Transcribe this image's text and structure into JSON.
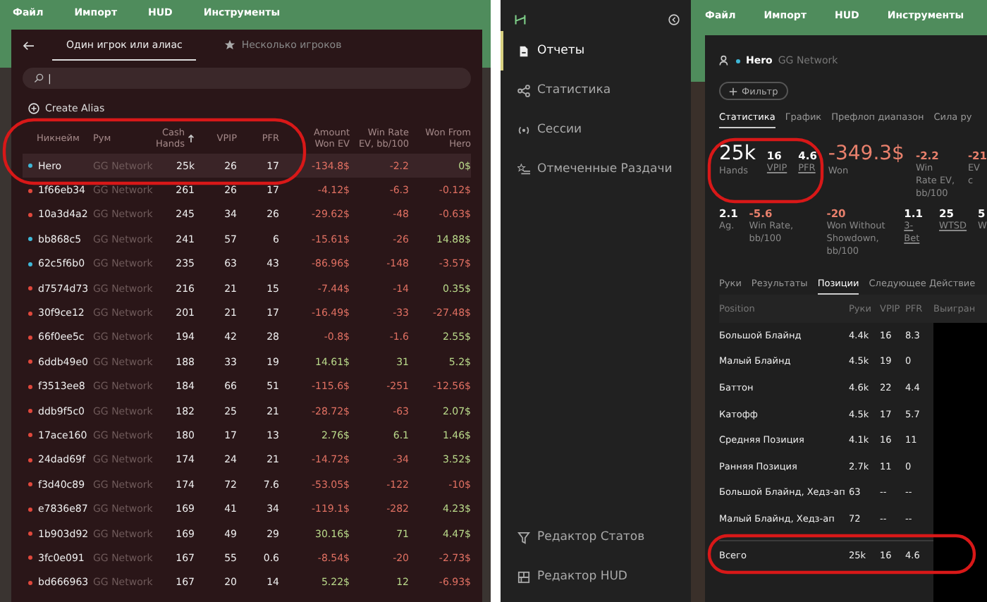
{
  "left": {
    "menu": [
      "Файл",
      "Импорт",
      "HUD",
      "Инструменты"
    ],
    "tabs": [
      {
        "label": "Один игрок или алиас",
        "selected": true,
        "kind": "back"
      },
      {
        "label": "Несколько игроков",
        "selected": false,
        "kind": "star"
      }
    ],
    "search": {
      "value": "|"
    },
    "create_alias": "Create Alias",
    "table": {
      "columns": [
        {
          "label": "Никнейм",
          "sorted": false
        },
        {
          "label": "Рум",
          "sorted": false
        },
        {
          "label": "Cash Hands",
          "sorted": true
        },
        {
          "label": "VPIP",
          "sorted": false
        },
        {
          "label": "PFR",
          "sorted": false
        },
        {
          "label": "Amount Won EV",
          "sorted": false
        },
        {
          "label": "Win Rate EV, bb/100",
          "sorted": false
        },
        {
          "label": "Won From Hero",
          "sorted": false
        }
      ],
      "rows": [
        {
          "color": "#3fb8d8",
          "selected": true,
          "cells": [
            "Hero",
            "GG Network",
            "25k",
            "26",
            "17",
            "-134.8$",
            "-2.2",
            "0$"
          ]
        },
        {
          "color": "#e0483c",
          "selected": false,
          "cells": [
            "1f66eb34",
            "GG Network",
            "261",
            "26",
            "17",
            "-4.12$",
            "-6.3",
            "-0.12$"
          ]
        },
        {
          "color": "#e0483c",
          "selected": false,
          "cells": [
            "10a3d4a2",
            "GG Network",
            "245",
            "34",
            "26",
            "-29.62$",
            "-48",
            "-0.63$"
          ]
        },
        {
          "color": "#3fb8d8",
          "selected": false,
          "cells": [
            "bb868c5",
            "GG Network",
            "241",
            "57",
            "6",
            "-15.61$",
            "-26",
            "14.88$"
          ]
        },
        {
          "color": "#3fb8d8",
          "selected": false,
          "cells": [
            "62c5f6b0",
            "GG Network",
            "235",
            "63",
            "43",
            "-86.96$",
            "-148",
            "-3.57$"
          ]
        },
        {
          "color": "#e0483c",
          "selected": false,
          "cells": [
            "d7574d73",
            "GG Network",
            "216",
            "21",
            "15",
            "-7.44$",
            "-14",
            "0.35$"
          ]
        },
        {
          "color": "#e0483c",
          "selected": false,
          "cells": [
            "30f9ce12",
            "GG Network",
            "201",
            "21",
            "17",
            "-16.49$",
            "-33",
            "-27.48$"
          ]
        },
        {
          "color": "#e0483c",
          "selected": false,
          "cells": [
            "66f0ee5c",
            "GG Network",
            "194",
            "42",
            "28",
            "-0.8$",
            "-1.6",
            "2.55$"
          ]
        },
        {
          "color": "#e0483c",
          "selected": false,
          "cells": [
            "6ddb49e0",
            "GG Network",
            "188",
            "33",
            "19",
            "14.61$",
            "31",
            "5.2$"
          ]
        },
        {
          "color": "#e0483c",
          "selected": false,
          "cells": [
            "f3513ee8",
            "GG Network",
            "184",
            "66",
            "51",
            "-115.6$",
            "-251",
            "-12.56$"
          ]
        },
        {
          "color": "#e0483c",
          "selected": false,
          "cells": [
            "ddb9f5c0",
            "GG Network",
            "182",
            "25",
            "21",
            "-28.72$",
            "-63",
            "2.07$"
          ]
        },
        {
          "color": "#e0483c",
          "selected": false,
          "cells": [
            "17ace160",
            "GG Network",
            "180",
            "17",
            "13",
            "2.76$",
            "6.1",
            "1.46$"
          ]
        },
        {
          "color": "#e0483c",
          "selected": false,
          "cells": [
            "24dad69f",
            "GG Network",
            "174",
            "24",
            "21",
            "-14.72$",
            "-34",
            "3.52$"
          ]
        },
        {
          "color": "#e0483c",
          "selected": false,
          "cells": [
            "f3d40c89",
            "GG Network",
            "174",
            "72",
            "7.6",
            "-53.05$",
            "-122",
            "-10$"
          ]
        },
        {
          "color": "#e0483c",
          "selected": false,
          "cells": [
            "e7836e87",
            "GG Network",
            "169",
            "41",
            "34",
            "-119.1$",
            "-282",
            "4.23$"
          ]
        },
        {
          "color": "#e0483c",
          "selected": false,
          "cells": [
            "1b903d92",
            "GG Network",
            "169",
            "49",
            "29",
            "30.16$",
            "71",
            "4.47$"
          ]
        },
        {
          "color": "#e0483c",
          "selected": false,
          "cells": [
            "3fc0e091",
            "GG Network",
            "167",
            "55",
            "0.6",
            "-8.54$",
            "-20",
            "-2.73$"
          ]
        },
        {
          "color": "#e0483c",
          "selected": false,
          "cells": [
            "bd666963",
            "GG Network",
            "167",
            "20",
            "14",
            "5.22$",
            "12",
            "-6.93$"
          ]
        }
      ]
    }
  },
  "right": {
    "sidebar": {
      "items": [
        {
          "label": "Отчеты",
          "selected": true,
          "kind": "report"
        },
        {
          "label": "Статистика",
          "selected": false,
          "kind": "share"
        },
        {
          "label": "Сессии",
          "selected": false,
          "kind": "radio"
        },
        {
          "label": "Отмеченные Раздачи",
          "selected": false,
          "kind": "starlist"
        }
      ],
      "bottom_items": [
        {
          "label": "Редактор Статов",
          "kind": "filter"
        },
        {
          "label": "Редактор HUD",
          "kind": "layout"
        }
      ]
    },
    "menu": [
      "Файл",
      "Импорт",
      "HUD",
      "Инструменты"
    ],
    "player": {
      "name": "Hero",
      "room": "GG Network",
      "color": "#3fb8d8"
    },
    "filter_button": "Фильтр",
    "tabs": [
      {
        "label": "Статистика",
        "selected": true
      },
      {
        "label": "График",
        "selected": false
      },
      {
        "label": "Префлоп диапазон",
        "selected": false
      },
      {
        "label": "Сила ру",
        "selected": false
      }
    ],
    "stats": [
      {
        "value": "25k",
        "label": "Hands",
        "kind": "big",
        "underlined": false
      },
      {
        "value": "16",
        "label": "VPIP",
        "kind": "small",
        "underlined": true
      },
      {
        "value": "4.6",
        "label": "PFR",
        "kind": "small",
        "underlined": true
      },
      {
        "value": "-349.3$",
        "label": "Won",
        "kind": "big",
        "underlined": false
      },
      {
        "value": "-2.2",
        "label": "Win Rate EV, bb/100",
        "kind": "small",
        "underlined": false
      },
      {
        "value": "-21",
        "label": "EV c",
        "kind": "small",
        "underlined": false
      }
    ],
    "stats_2": [
      {
        "value": "2.1",
        "label": "Ag.",
        "underlined": false
      },
      {
        "value": "-5.6",
        "label": "Win Rate, bb/100",
        "underlined": false
      },
      {
        "value": "-20",
        "label": "Won Without Showdown, bb/100",
        "underlined": false
      },
      {
        "value": "1.1",
        "label": "3-Bet",
        "underlined": true
      },
      {
        "value": "25",
        "label": "WTSD",
        "underlined": true
      },
      {
        "value": "5",
        "label": "W",
        "underlined": false
      }
    ],
    "sub_tabs": [
      {
        "label": "Руки",
        "selected": false
      },
      {
        "label": "Результаты",
        "selected": false
      },
      {
        "label": "Позиции",
        "selected": true
      },
      {
        "label": "Следующее Действие",
        "selected": false
      }
    ],
    "positions": {
      "columns": [
        "Position",
        "Руки",
        "VPIP",
        "PFR",
        "Выигран"
      ],
      "rows": [
        [
          "Большой Блайнд",
          "4.4k",
          "16",
          "8.3"
        ],
        [
          "Малый Блайнд",
          "4.5k",
          "19",
          "0"
        ],
        [
          "Баттон",
          "4.6k",
          "22",
          "4.4"
        ],
        [
          "Катофф",
          "4.5k",
          "17",
          "5.7"
        ],
        [
          "Средняя Позиция",
          "4.1k",
          "16",
          "11"
        ],
        [
          "Ранняя Позиция",
          "2.7k",
          "11",
          "0"
        ],
        [
          "Большой Блайнд, Хедз-ап",
          "63",
          "--",
          "--"
        ],
        [
          "Малый Блайнд, Хедз-ап",
          "72",
          "--",
          "--"
        ]
      ],
      "total": [
        "Всего",
        "25k",
        "16",
        "4.6"
      ]
    }
  }
}
